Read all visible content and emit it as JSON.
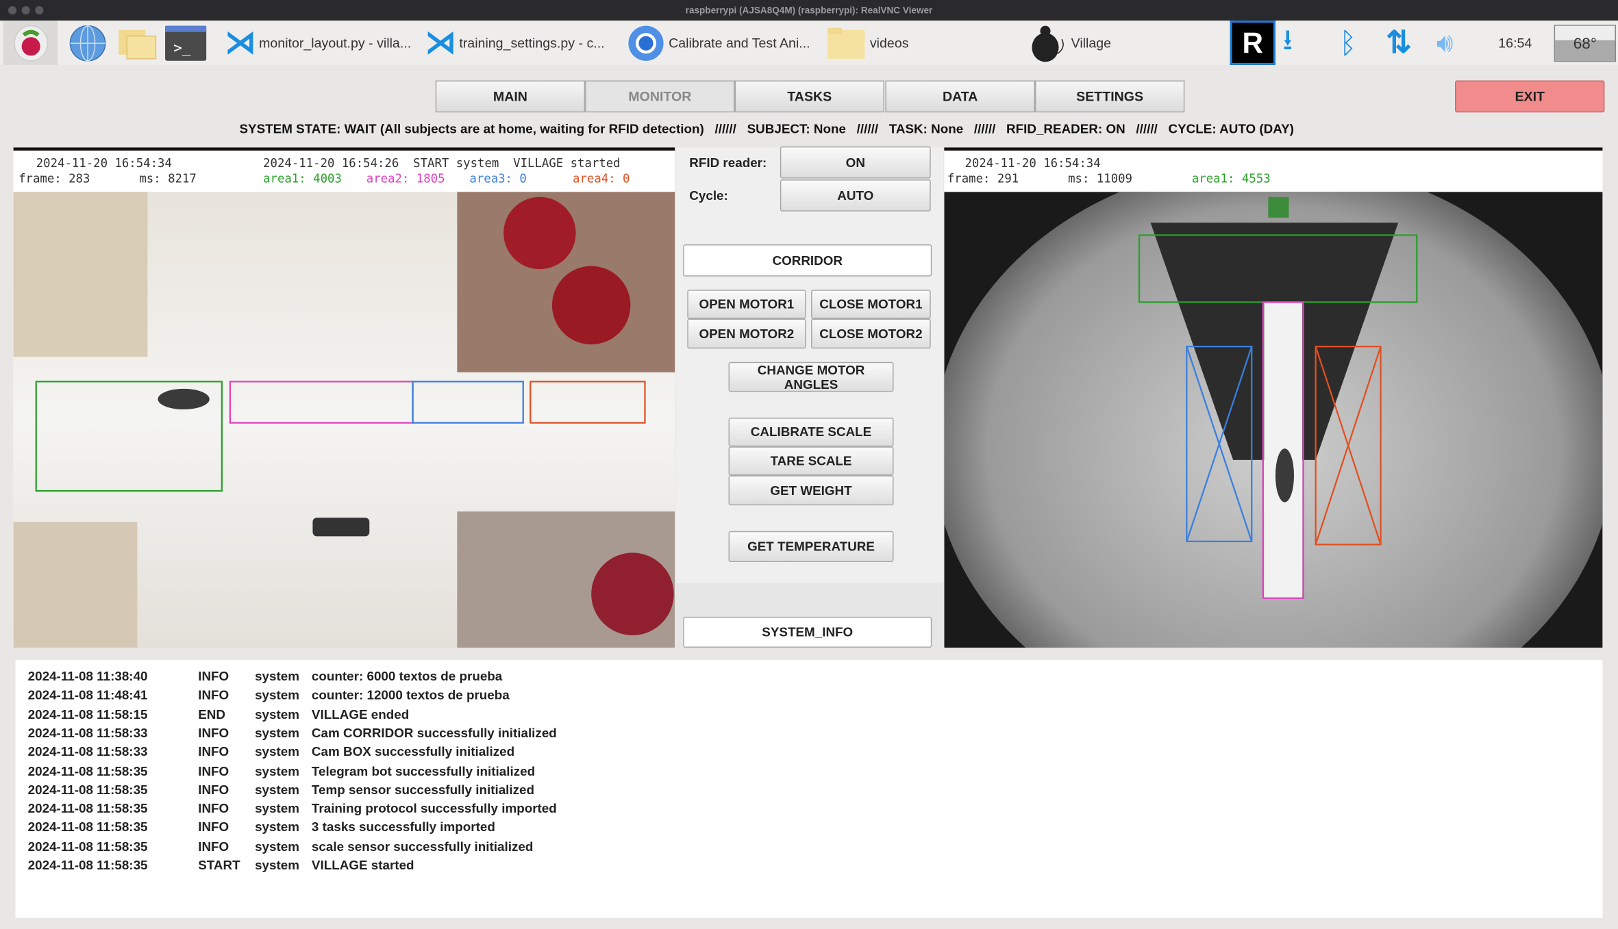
{
  "window": {
    "title": "raspberrypi (AJSA8Q4M) (raspberrypi): RealVNC Viewer"
  },
  "taskbar": {
    "apps": [
      {
        "label": "monitor_layout.py - villa...",
        "icon": "vscode-icon"
      },
      {
        "label": "training_settings.py - c...",
        "icon": "vscode-icon"
      },
      {
        "label": "Calibrate and Test Ani...",
        "icon": "chromium-icon"
      },
      {
        "label": "videos",
        "icon": "folder-icon"
      },
      {
        "label": "Village",
        "icon": "mouse-icon"
      }
    ],
    "clock": "16:54",
    "temperature": "68°"
  },
  "tabs": [
    "MAIN",
    "MONITOR",
    "TASKS",
    "DATA",
    "SETTINGS"
  ],
  "active_tab": "MONITOR",
  "exit_label": "EXIT",
  "status": {
    "system_state": "SYSTEM STATE: WAIT (All subjects are at home, waiting for RFID detection)",
    "sep": "//////",
    "subject": "SUBJECT: None",
    "task": "TASK: None",
    "rfid": "RFID_READER: ON",
    "cycle": "CYCLE: AUTO (DAY)"
  },
  "cam_box": {
    "timestamp": "2024-11-20 16:54:34",
    "frame": "frame: 283",
    "ms": "ms: 8217",
    "event": "2024-11-20 16:54:26  START system  VILLAGE started",
    "areas": [
      {
        "text": "area1: 4003",
        "color": "#2aa02a"
      },
      {
        "text": "area2: 1805",
        "color": "#e040c0"
      },
      {
        "text": "area3: 0",
        "color": "#3a7fe0"
      },
      {
        "text": "area4: 0",
        "color": "#e05020"
      }
    ]
  },
  "cam_corridor": {
    "timestamp": "2024-11-20 16:54:34",
    "frame": "frame: 291",
    "ms": "ms: 11009",
    "area": {
      "text": "area1: 4553",
      "color": "#2aa02a"
    }
  },
  "controls": {
    "rfid_label": "RFID reader:",
    "rfid_value": "ON",
    "cycle_label": "Cycle:",
    "cycle_value": "AUTO",
    "corridor": "CORRIDOR",
    "open_motor1": "OPEN MOTOR1",
    "close_motor1": "CLOSE MOTOR1",
    "open_motor2": "OPEN MOTOR2",
    "close_motor2": "CLOSE MOTOR2",
    "change_angles": "CHANGE MOTOR ANGLES",
    "calibrate": "CALIBRATE SCALE",
    "tare": "TARE SCALE",
    "weight": "GET WEIGHT",
    "temperature": "GET TEMPERATURE",
    "system_info": "SYSTEM_INFO"
  },
  "log": [
    [
      "2024-11-08 11:38:40",
      "INFO",
      "system",
      "counter: 6000 textos de prueba"
    ],
    [
      "2024-11-08 11:48:41",
      "INFO",
      "system",
      "counter: 12000 textos de prueba"
    ],
    [
      "2024-11-08 11:58:15",
      "END",
      "system",
      "VILLAGE ended"
    ],
    [
      "2024-11-08 11:58:33",
      "INFO",
      "system",
      "Cam CORRIDOR successfully initialized"
    ],
    [
      "2024-11-08 11:58:33",
      "INFO",
      "system",
      "Cam BOX successfully initialized"
    ],
    [
      "2024-11-08 11:58:35",
      "INFO",
      "system",
      "Telegram bot successfully initialized"
    ],
    [
      "2024-11-08 11:58:35",
      "INFO",
      "system",
      "Temp sensor successfully initialized"
    ],
    [
      "2024-11-08 11:58:35",
      "INFO",
      "system",
      "Training protocol successfully imported"
    ],
    [
      "2024-11-08 11:58:35",
      "INFO",
      "system",
      "3 tasks successfully imported"
    ],
    [
      "2024-11-08 11:58:35",
      "INFO",
      "system",
      "scale sensor successfully initialized"
    ],
    [
      "2024-11-08 11:58:35",
      "START",
      "system",
      "VILLAGE started"
    ]
  ]
}
